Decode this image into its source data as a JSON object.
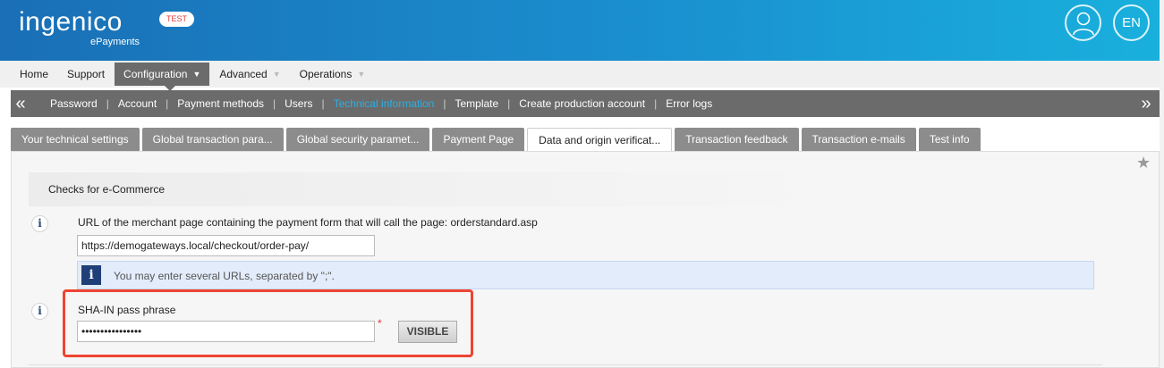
{
  "header": {
    "brand": "ingenico",
    "brand_sub": "ePayments",
    "env_badge": "TEST",
    "language": "EN",
    "user_icon": "user-icon"
  },
  "main_menu": {
    "items": [
      {
        "label": "Home"
      },
      {
        "label": "Support"
      },
      {
        "label": "Configuration",
        "active": true
      },
      {
        "label": "Advanced"
      },
      {
        "label": "Operations"
      }
    ]
  },
  "sub_menu": {
    "left_arrow": "«",
    "right_arrow": "»",
    "items": [
      {
        "label": "Password"
      },
      {
        "label": "Account"
      },
      {
        "label": "Payment methods"
      },
      {
        "label": "Users"
      },
      {
        "label": "Technical information",
        "active": true
      },
      {
        "label": "Template"
      },
      {
        "label": "Create production account"
      },
      {
        "label": "Error logs"
      }
    ]
  },
  "tabs": [
    {
      "label": "Your technical settings"
    },
    {
      "label": "Global transaction para..."
    },
    {
      "label": "Global security paramet..."
    },
    {
      "label": "Payment Page"
    },
    {
      "label": "Data and origin verificat...",
      "active": true
    },
    {
      "label": "Transaction feedback"
    },
    {
      "label": "Transaction e-mails"
    },
    {
      "label": "Test info"
    }
  ],
  "section": {
    "title": "Checks for e-Commerce",
    "url_field": {
      "label": "URL of the merchant page containing the payment form that will call the page: orderstandard.asp",
      "value": "https://demogateways.local/checkout/order-pay/"
    },
    "note": "You may enter several URLs, separated by \";\".",
    "sha_field": {
      "label": "SHA-IN pass phrase",
      "value": "••••••••••••••••",
      "required_mark": "*",
      "visible_button": "VISIBLE"
    }
  },
  "colors": {
    "header_gradient_start": "#1a6fb6",
    "header_gradient_end": "#19b0dd",
    "active_link": "#2ab0e3",
    "highlight": "#ee4433"
  }
}
